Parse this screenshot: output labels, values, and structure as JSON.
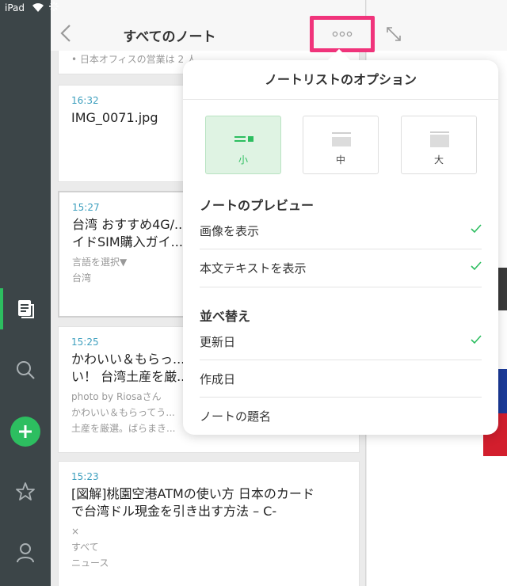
{
  "status": {
    "carrier": "iPad"
  },
  "header": {
    "title": "すべてのノート"
  },
  "notes": [
    {
      "time": "",
      "title": "",
      "snippets": [
        "• 日本オフィスの営業は 2 人"
      ]
    },
    {
      "time": "16:32",
      "title": "IMG_0071.jpg",
      "snippets": []
    },
    {
      "time": "15:27",
      "title": "台湾 おすすめ4G/...\nイドSIM購入ガイ...",
      "snippets": [
        "言語を選択▼",
        "台湾"
      ]
    },
    {
      "time": "15:25",
      "title": "かわいい＆もらっ...\nい！ 台湾土産を厳...",
      "snippets": [
        "photo by Riosaさん",
        "かわいい＆もらってう...",
        "土産を厳選。ばらまき..."
      ]
    },
    {
      "time": "15:23",
      "title": "[図解]桃園空港ATMの使い方 日本のカード\nで台湾ドル現金を引き出す方法 – C-",
      "snippets": [
        "×",
        "すべて",
        "ニュース"
      ]
    }
  ],
  "popover": {
    "title": "ノートリストのオプション",
    "sizes": [
      {
        "label": "小",
        "active": true
      },
      {
        "label": "中",
        "active": false
      },
      {
        "label": "大",
        "active": false
      }
    ],
    "preview_heading": "ノートのプレビュー",
    "preview_options": [
      {
        "label": "画像を表示",
        "checked": true
      },
      {
        "label": "本文テキストを表示",
        "checked": true
      }
    ],
    "sort_heading": "並べ替え",
    "sort_options": [
      {
        "label": "更新日",
        "checked": true
      },
      {
        "label": "作成日",
        "checked": false
      },
      {
        "label": "ノートの題名",
        "checked": false
      }
    ]
  },
  "colors": {
    "accent": "#2dbe60",
    "highlight": "#f0347b",
    "rail": "#3c4548",
    "time": "#3d9fbe"
  },
  "icons": [
    "wifi-icon",
    "back-chevron-icon",
    "more-dots-icon",
    "expand-icon",
    "notes-icon",
    "search-icon",
    "add-icon",
    "star-icon",
    "account-icon",
    "checkmark-icon"
  ]
}
